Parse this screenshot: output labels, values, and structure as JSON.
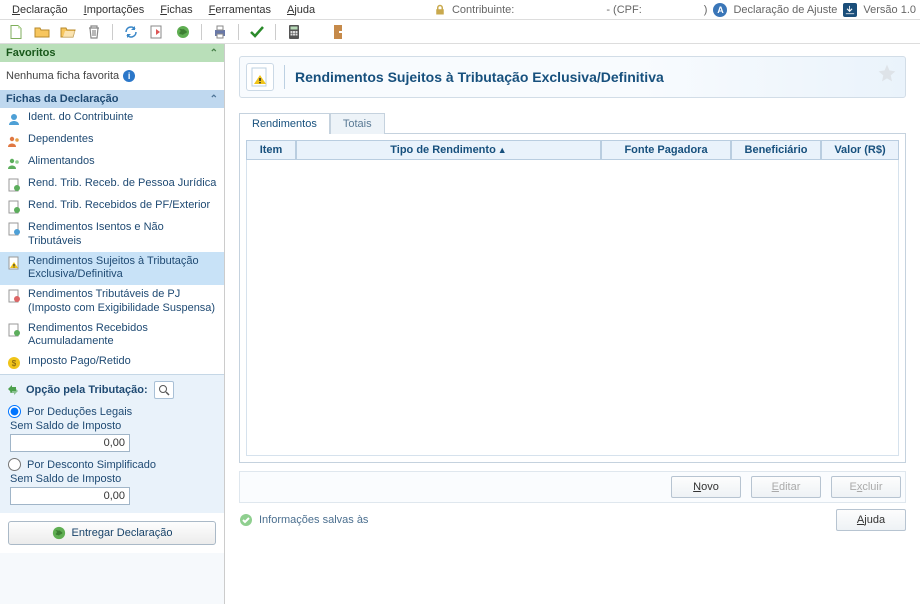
{
  "menu": {
    "items": [
      "Declaração",
      "Importações",
      "Fichas",
      "Ferramentas",
      "Ajuda"
    ]
  },
  "status": {
    "contribuinte_label": "Contribuinte:",
    "cpf_label": "- (CPF:",
    "cpf_end": ")",
    "declaracao_tipo": "Declaração de Ajuste",
    "versao": "Versão 1.0"
  },
  "sidebar": {
    "favoritos_header": "Favoritos",
    "nenhuma_ficha": "Nenhuma ficha favorita",
    "fichas_header": "Fichas da Declaração",
    "itens": [
      {
        "label": "Ident. do Contribuinte"
      },
      {
        "label": "Dependentes"
      },
      {
        "label": "Alimentandos"
      },
      {
        "label": "Rend. Trib. Receb. de Pessoa Jurídica"
      },
      {
        "label": "Rend. Trib. Recebidos de PF/Exterior"
      },
      {
        "label": "Rendimentos Isentos e Não Tributáveis"
      },
      {
        "label": "Rendimentos Sujeitos à Tributação Exclusiva/Definitiva"
      },
      {
        "label": "Rendimentos Tributáveis de PJ (Imposto com Exigibilidade Suspensa)"
      },
      {
        "label": "Rendimentos Recebidos Acumuladamente"
      },
      {
        "label": "Imposto Pago/Retido"
      }
    ],
    "opcao_label": "Opção pela Tributação:",
    "opt1": "Por Deduções Legais",
    "opt2": "Por Desconto Simplificado",
    "sub1": "Sem Saldo de Imposto",
    "sub2": "Sem Saldo de Imposto",
    "val1": "0,00",
    "val2": "0,00",
    "deliver": "Entregar Declaração"
  },
  "content": {
    "title": "Rendimentos Sujeitos à Tributação Exclusiva/Definitiva",
    "tabs": {
      "rend": "Rendimentos",
      "totais": "Totais"
    },
    "cols": {
      "item": "Item",
      "tipo": "Tipo de Rendimento",
      "fonte": "Fonte Pagadora",
      "benef": "Beneficiário",
      "valor": "Valor (R$)"
    },
    "btn_novo": "Novo",
    "btn_editar": "Editar",
    "btn_excluir": "Excluir",
    "footer": "Informações salvas às",
    "ajuda": "Ajuda"
  }
}
